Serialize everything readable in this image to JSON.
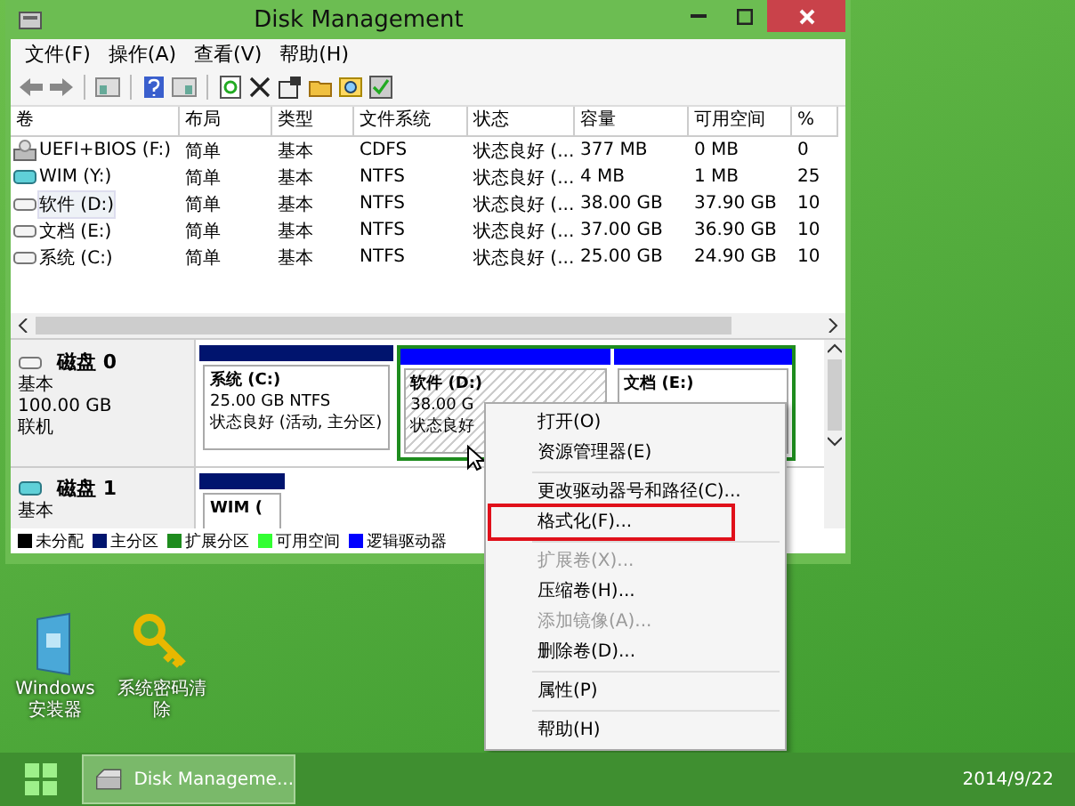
{
  "window": {
    "title": "Disk Management"
  },
  "menu": [
    "文件(F)",
    "操作(A)",
    "查看(V)",
    "帮助(H)"
  ],
  "volumes": {
    "columns": [
      "卷",
      "布局",
      "类型",
      "文件系统",
      "状态",
      "容量",
      "可用空间",
      "%"
    ],
    "rows": [
      {
        "selected": false,
        "cells": [
          "UEFI+BIOS (F:)",
          "简单",
          "基本",
          "CDFS",
          "状态良好 (...",
          "377 MB",
          "0 MB",
          "0"
        ]
      },
      {
        "selected": false,
        "cells": [
          "WIM (Y:)",
          "简单",
          "基本",
          "NTFS",
          "状态良好 (...",
          "4 MB",
          "1 MB",
          "25"
        ]
      },
      {
        "selected": true,
        "cells": [
          "软件 (D:)",
          "简单",
          "基本",
          "NTFS",
          "状态良好 (...",
          "38.00 GB",
          "37.90 GB",
          "10"
        ]
      },
      {
        "selected": false,
        "cells": [
          "文档 (E:)",
          "简单",
          "基本",
          "NTFS",
          "状态良好 (...",
          "37.00 GB",
          "36.90 GB",
          "10"
        ]
      },
      {
        "selected": false,
        "cells": [
          "系统 (C:)",
          "简单",
          "基本",
          "NTFS",
          "状态良好 (...",
          "25.00 GB",
          "24.90 GB",
          "10"
        ]
      }
    ]
  },
  "disks": [
    {
      "name": "磁盘 0",
      "details": [
        "基本",
        "100.00 GB",
        "联机"
      ],
      "partitions": [
        {
          "kind": "primary",
          "selected": false,
          "lines": [
            "系统 (C:)",
            "25.00 GB NTFS",
            "状态良好 (活动, 主分区)"
          ]
        },
        {
          "kind": "extended",
          "children": [
            {
              "kind": "logical",
              "selected": true,
              "lines": [
                "软件 (D:)",
                "38.00 G",
                "状态良好"
              ]
            },
            {
              "kind": "logical",
              "selected": false,
              "lines": [
                "文档 (E:)"
              ]
            }
          ]
        }
      ]
    },
    {
      "name": "磁盘 1",
      "details": [
        "基本"
      ],
      "partitions": [
        {
          "kind": "primary",
          "selected": false,
          "lines": [
            "WIM ("
          ]
        }
      ]
    }
  ],
  "legend": [
    {
      "label": "未分配",
      "color": "#000000"
    },
    {
      "label": "主分区",
      "color": "#00146e"
    },
    {
      "label": "扩展分区",
      "color": "#1e8c1e"
    },
    {
      "label": "可用空间",
      "color": "#32ff32"
    },
    {
      "label": "逻辑驱动器",
      "color": "#0000ff"
    }
  ],
  "context_menu": [
    {
      "kind": "item",
      "label": "打开(O)",
      "disabled": false,
      "highlighted": false
    },
    {
      "kind": "item",
      "label": "资源管理器(E)",
      "disabled": false,
      "highlighted": false
    },
    {
      "kind": "separator"
    },
    {
      "kind": "item",
      "label": "更改驱动器号和路径(C)...",
      "disabled": false,
      "highlighted": false
    },
    {
      "kind": "item",
      "label": "格式化(F)...",
      "disabled": false,
      "highlighted": true
    },
    {
      "kind": "separator"
    },
    {
      "kind": "item",
      "label": "扩展卷(X)...",
      "disabled": true,
      "highlighted": false
    },
    {
      "kind": "item",
      "label": "压缩卷(H)...",
      "disabled": false,
      "highlighted": false
    },
    {
      "kind": "item",
      "label": "添加镜像(A)...",
      "disabled": true,
      "highlighted": false
    },
    {
      "kind": "item",
      "label": "删除卷(D)...",
      "disabled": false,
      "highlighted": false
    },
    {
      "kind": "separator"
    },
    {
      "kind": "item",
      "label": "属性(P)",
      "disabled": false,
      "highlighted": false
    },
    {
      "kind": "separator"
    },
    {
      "kind": "item",
      "label": "帮助(H)",
      "disabled": false,
      "highlighted": false
    }
  ],
  "desktop_icons": [
    {
      "kind": "installer",
      "label": "Windows安装器"
    },
    {
      "kind": "key",
      "label": "系统密码清除"
    }
  ],
  "taskbar": {
    "task": "Disk Manageme...",
    "date": "2014/9/22"
  }
}
